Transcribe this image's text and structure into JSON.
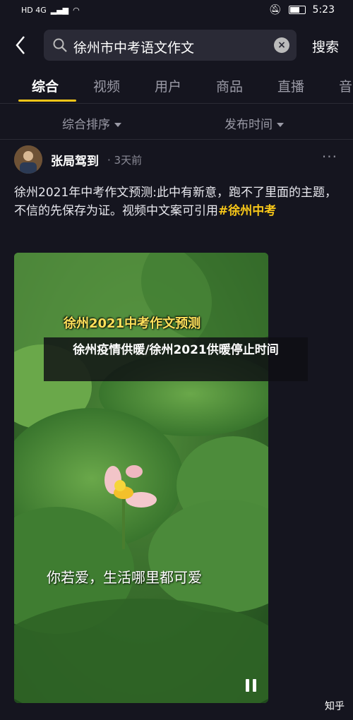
{
  "status_bar": {
    "network": "HD 4G",
    "time": "5:23"
  },
  "search": {
    "query": "徐州市中考语文作文",
    "button_label": "搜索"
  },
  "tabs": [
    {
      "label": "综合",
      "active": true
    },
    {
      "label": "视频",
      "active": false
    },
    {
      "label": "用户",
      "active": false
    },
    {
      "label": "商品",
      "active": false
    },
    {
      "label": "直播",
      "active": false
    },
    {
      "label": "音",
      "active": false
    }
  ],
  "filters": {
    "sort": "综合排序",
    "time": "发布时间"
  },
  "post": {
    "author": "张局驾到",
    "time": "· 3天前",
    "more": "···",
    "description": "徐州2021年中考作文预测:此中有新意，跑不了里面的主题，不信的先保存为证。视频中文案可引用",
    "hashtag": "#徐州中考",
    "video_title": "徐州2021中考作文预测",
    "video_caption": "你若爱，生活哪里都可爱"
  },
  "overlay_text": "徐州疫情供暖/徐州2021供暖停止时间",
  "watermark": "知乎",
  "colors": {
    "accent": "#f5c518",
    "background": "#15151f"
  }
}
